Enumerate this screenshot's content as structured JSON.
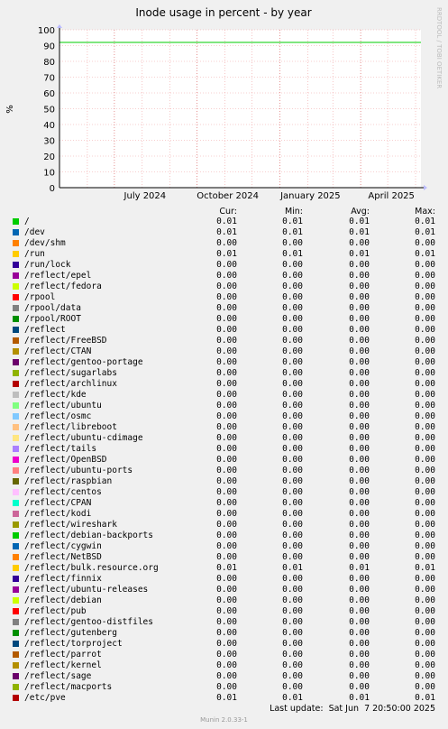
{
  "chart_data": {
    "type": "line",
    "title": "Inode usage in percent - by year",
    "ylabel": "%",
    "side_label": "RRDTOOL / TOBI OETIKER",
    "ylim": [
      0,
      100
    ],
    "yticks": [
      "0",
      "10",
      "20",
      "30",
      "40",
      "50",
      "60",
      "70",
      "80",
      "90",
      "100"
    ],
    "xlim": [
      "2024-05-01",
      "2025-06-07"
    ],
    "xticks": [
      {
        "date": "2024-07-01",
        "label": "July 2024"
      },
      {
        "date": "2024-10-01",
        "label": "October 2024"
      },
      {
        "date": "2025-01-01",
        "label": "January 2025"
      },
      {
        "date": "2025-04-01",
        "label": "April 2025"
      }
    ],
    "grid": true,
    "lines": [
      {
        "value": 92,
        "color": "#00cc00"
      },
      {
        "value": 0,
        "color": "#cc0000"
      }
    ],
    "columns": [
      "Cur:",
      "Min:",
      "Avg:",
      "Max:"
    ],
    "series": [
      {
        "name": "/",
        "color": "#00cc00",
        "values": [
          "0.01",
          "0.01",
          "0.01",
          "0.01"
        ]
      },
      {
        "name": "/dev",
        "color": "#0066b3",
        "values": [
          "0.01",
          "0.01",
          "0.01",
          "0.01"
        ]
      },
      {
        "name": "/dev/shm",
        "color": "#ff8000",
        "values": [
          "0.00",
          "0.00",
          "0.00",
          "0.00"
        ]
      },
      {
        "name": "/run",
        "color": "#ffcc00",
        "values": [
          "0.01",
          "0.01",
          "0.01",
          "0.01"
        ]
      },
      {
        "name": "/run/lock",
        "color": "#330099",
        "values": [
          "0.00",
          "0.00",
          "0.00",
          "0.00"
        ]
      },
      {
        "name": "/reflect/epel",
        "color": "#990099",
        "values": [
          "0.00",
          "0.00",
          "0.00",
          "0.00"
        ]
      },
      {
        "name": "/reflect/fedora",
        "color": "#ccff00",
        "values": [
          "0.00",
          "0.00",
          "0.00",
          "0.00"
        ]
      },
      {
        "name": "/rpool",
        "color": "#ff0000",
        "values": [
          "0.00",
          "0.00",
          "0.00",
          "0.00"
        ]
      },
      {
        "name": "/rpool/data",
        "color": "#808080",
        "values": [
          "0.00",
          "0.00",
          "0.00",
          "0.00"
        ]
      },
      {
        "name": "/rpool/ROOT",
        "color": "#008f00",
        "values": [
          "0.00",
          "0.00",
          "0.00",
          "0.00"
        ]
      },
      {
        "name": "/reflect",
        "color": "#00487d",
        "values": [
          "0.00",
          "0.00",
          "0.00",
          "0.00"
        ]
      },
      {
        "name": "/reflect/FreeBSD",
        "color": "#b35a00",
        "values": [
          "0.00",
          "0.00",
          "0.00",
          "0.00"
        ]
      },
      {
        "name": "/reflect/CTAN",
        "color": "#b38f00",
        "values": [
          "0.00",
          "0.00",
          "0.00",
          "0.00"
        ]
      },
      {
        "name": "/reflect/gentoo-portage",
        "color": "#6b006b",
        "values": [
          "0.00",
          "0.00",
          "0.00",
          "0.00"
        ]
      },
      {
        "name": "/reflect/sugarlabs",
        "color": "#8fb300",
        "values": [
          "0.00",
          "0.00",
          "0.00",
          "0.00"
        ]
      },
      {
        "name": "/reflect/archlinux",
        "color": "#b30000",
        "values": [
          "0.00",
          "0.00",
          "0.00",
          "0.00"
        ]
      },
      {
        "name": "/reflect/kde",
        "color": "#bebebe",
        "values": [
          "0.00",
          "0.00",
          "0.00",
          "0.00"
        ]
      },
      {
        "name": "/reflect/ubuntu",
        "color": "#80ff80",
        "values": [
          "0.00",
          "0.00",
          "0.00",
          "0.00"
        ]
      },
      {
        "name": "/reflect/osmc",
        "color": "#80c9ff",
        "values": [
          "0.00",
          "0.00",
          "0.00",
          "0.00"
        ]
      },
      {
        "name": "/reflect/libreboot",
        "color": "#ffc080",
        "values": [
          "0.00",
          "0.00",
          "0.00",
          "0.00"
        ]
      },
      {
        "name": "/reflect/ubuntu-cdimage",
        "color": "#ffe680",
        "values": [
          "0.00",
          "0.00",
          "0.00",
          "0.00"
        ]
      },
      {
        "name": "/reflect/tails",
        "color": "#aa80ff",
        "values": [
          "0.00",
          "0.00",
          "0.00",
          "0.00"
        ]
      },
      {
        "name": "/reflect/OpenBSD",
        "color": "#ee00cc",
        "values": [
          "0.00",
          "0.00",
          "0.00",
          "0.00"
        ]
      },
      {
        "name": "/reflect/ubuntu-ports",
        "color": "#ff8080",
        "values": [
          "0.00",
          "0.00",
          "0.00",
          "0.00"
        ]
      },
      {
        "name": "/reflect/raspbian",
        "color": "#666600",
        "values": [
          "0.00",
          "0.00",
          "0.00",
          "0.00"
        ]
      },
      {
        "name": "/reflect/centos",
        "color": "#ffbfff",
        "values": [
          "0.00",
          "0.00",
          "0.00",
          "0.00"
        ]
      },
      {
        "name": "/reflect/CPAN",
        "color": "#00ffcc",
        "values": [
          "0.00",
          "0.00",
          "0.00",
          "0.00"
        ]
      },
      {
        "name": "/reflect/kodi",
        "color": "#cc6699",
        "values": [
          "0.00",
          "0.00",
          "0.00",
          "0.00"
        ]
      },
      {
        "name": "/reflect/wireshark",
        "color": "#999900",
        "values": [
          "0.00",
          "0.00",
          "0.00",
          "0.00"
        ]
      },
      {
        "name": "/reflect/debian-backports",
        "color": "#00cc00",
        "values": [
          "0.00",
          "0.00",
          "0.00",
          "0.00"
        ]
      },
      {
        "name": "/reflect/cygwin",
        "color": "#0066b3",
        "values": [
          "0.00",
          "0.00",
          "0.00",
          "0.00"
        ]
      },
      {
        "name": "/reflect/NetBSD",
        "color": "#ff8000",
        "values": [
          "0.00",
          "0.00",
          "0.00",
          "0.00"
        ]
      },
      {
        "name": "/reflect/bulk.resource.org",
        "color": "#ffcc00",
        "values": [
          "0.01",
          "0.01",
          "0.01",
          "0.01"
        ]
      },
      {
        "name": "/reflect/finnix",
        "color": "#330099",
        "values": [
          "0.00",
          "0.00",
          "0.00",
          "0.00"
        ]
      },
      {
        "name": "/reflect/ubuntu-releases",
        "color": "#990099",
        "values": [
          "0.00",
          "0.00",
          "0.00",
          "0.00"
        ]
      },
      {
        "name": "/reflect/debian",
        "color": "#ccff00",
        "values": [
          "0.00",
          "0.00",
          "0.00",
          "0.00"
        ]
      },
      {
        "name": "/reflect/pub",
        "color": "#ff0000",
        "values": [
          "0.00",
          "0.00",
          "0.00",
          "0.00"
        ]
      },
      {
        "name": "/reflect/gentoo-distfiles",
        "color": "#808080",
        "values": [
          "0.00",
          "0.00",
          "0.00",
          "0.00"
        ]
      },
      {
        "name": "/reflect/gutenberg",
        "color": "#008f00",
        "values": [
          "0.00",
          "0.00",
          "0.00",
          "0.00"
        ]
      },
      {
        "name": "/reflect/torproject",
        "color": "#00487d",
        "values": [
          "0.00",
          "0.00",
          "0.00",
          "0.00"
        ]
      },
      {
        "name": "/reflect/parrot",
        "color": "#b35a00",
        "values": [
          "0.00",
          "0.00",
          "0.00",
          "0.00"
        ]
      },
      {
        "name": "/reflect/kernel",
        "color": "#b38f00",
        "values": [
          "0.00",
          "0.00",
          "0.00",
          "0.00"
        ]
      },
      {
        "name": "/reflect/sage",
        "color": "#6b006b",
        "values": [
          "0.00",
          "0.00",
          "0.00",
          "0.00"
        ]
      },
      {
        "name": "/reflect/macports",
        "color": "#8fb300",
        "values": [
          "0.00",
          "0.00",
          "0.00",
          "0.00"
        ]
      },
      {
        "name": "/etc/pve",
        "color": "#b30000",
        "values": [
          "0.01",
          "0.01",
          "0.01",
          "0.01"
        ]
      }
    ]
  },
  "footer": {
    "last_update": "Last update:  Sat Jun  7 20:50:00 2025",
    "version": "Munin 2.0.33-1"
  }
}
